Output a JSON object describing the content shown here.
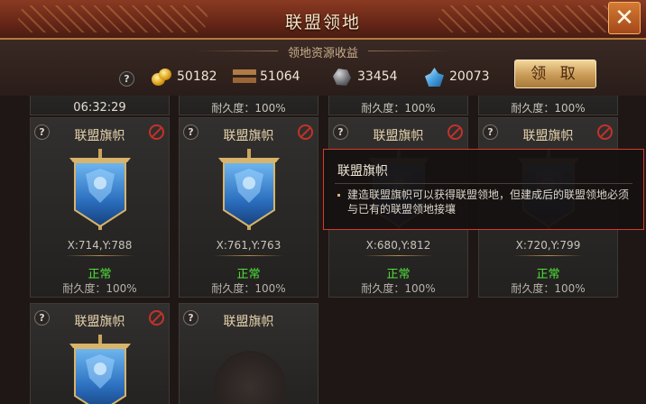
{
  "window": {
    "title": "联盟领地",
    "close_icon": "✕"
  },
  "resources": {
    "section_title": "领地资源收益",
    "help_icon": "?",
    "items": [
      {
        "icon": "gold-icon",
        "value": "50182"
      },
      {
        "icon": "wood-icon",
        "value": "51064"
      },
      {
        "icon": "stone-icon",
        "value": "33454"
      },
      {
        "icon": "crystal-icon",
        "value": "20073"
      }
    ],
    "claim_label": "领 取"
  },
  "top_row": {
    "timer": "06:32:29",
    "durability_texts": [
      "耐久度：100%",
      "耐久度：100%",
      "耐久度：100%"
    ]
  },
  "cards": [
    {
      "name": "联盟旗帜",
      "coord": "X:714,Y:788",
      "status": "正常",
      "durability": "耐久度：100%"
    },
    {
      "name": "联盟旗帜",
      "coord": "X:761,Y:763",
      "status": "正常",
      "durability": "耐久度：100%"
    },
    {
      "name": "联盟旗帜",
      "coord": "X:680,Y:812",
      "status": "正常",
      "durability": "耐久度：100%"
    },
    {
      "name": "联盟旗帜",
      "coord": "X:720,Y:799",
      "status": "正常",
      "durability": "耐久度：100%"
    },
    {
      "name": "联盟旗帜"
    },
    {
      "name": "联盟旗帜"
    }
  ],
  "tooltip": {
    "title": "联盟旗帜",
    "body": "建造联盟旗帜可以获得联盟领地，但建成后的联盟领地必须与已有的联盟领地接壤"
  },
  "colors": {
    "status_ok": "#4ee13a",
    "tooltip_border": "#d8392a",
    "accent_gold": "#c89a56"
  }
}
